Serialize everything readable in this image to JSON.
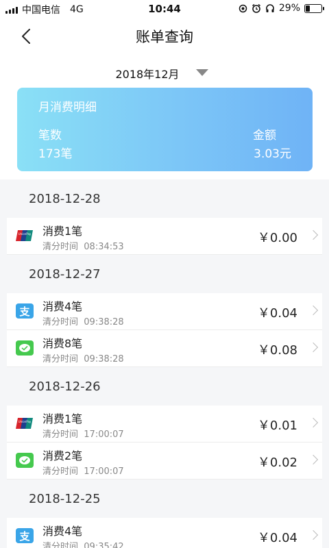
{
  "status_bar": {
    "carrier": "中国电信",
    "network": "4G",
    "time": "10:44",
    "battery_percent": "29%",
    "battery_level": 0.29
  },
  "header": {
    "title": "账单查询",
    "back_icon": "chevron-left-icon"
  },
  "month_selector": {
    "value": "2018年12月",
    "arrow_icon": "caret-down-icon"
  },
  "summary": {
    "title": "月消费明细",
    "count_label": "笔数",
    "count_value": "173笔",
    "amount_label": "金额",
    "amount_value": "3.03元"
  },
  "groups": [
    {
      "date": "2018-12-28",
      "items": [
        {
          "icon": "unionpay-icon",
          "title": "消费1笔",
          "time_label": "清分时间",
          "time": "08:34:53",
          "amount": "￥0.00"
        }
      ]
    },
    {
      "date": "2018-12-27",
      "items": [
        {
          "icon": "alipay-icon",
          "title": "消费4笔",
          "time_label": "清分时间",
          "time": "09:38:28",
          "amount": "￥0.04"
        },
        {
          "icon": "wechat-pay-icon",
          "title": "消费8笔",
          "time_label": "清分时间",
          "time": "09:38:28",
          "amount": "￥0.08"
        }
      ]
    },
    {
      "date": "2018-12-26",
      "items": [
        {
          "icon": "unionpay-icon",
          "title": "消费1笔",
          "time_label": "清分时间",
          "time": "17:00:07",
          "amount": "￥0.01"
        },
        {
          "icon": "wechat-pay-icon",
          "title": "消费2笔",
          "time_label": "清分时间",
          "time": "17:00:07",
          "amount": "￥0.02"
        }
      ]
    },
    {
      "date": "2018-12-25",
      "items": [
        {
          "icon": "alipay-icon",
          "title": "消费4笔",
          "time_label": "清分时间",
          "time": "09:35:42",
          "amount": "￥0.04"
        }
      ]
    }
  ],
  "colors": {
    "card_gradient_start": "#8ae0f6",
    "card_gradient_end": "#6fb3f6",
    "alipay": "#3aa5e8",
    "wechat": "#45c94e",
    "list_background": "#f5f6f8"
  }
}
